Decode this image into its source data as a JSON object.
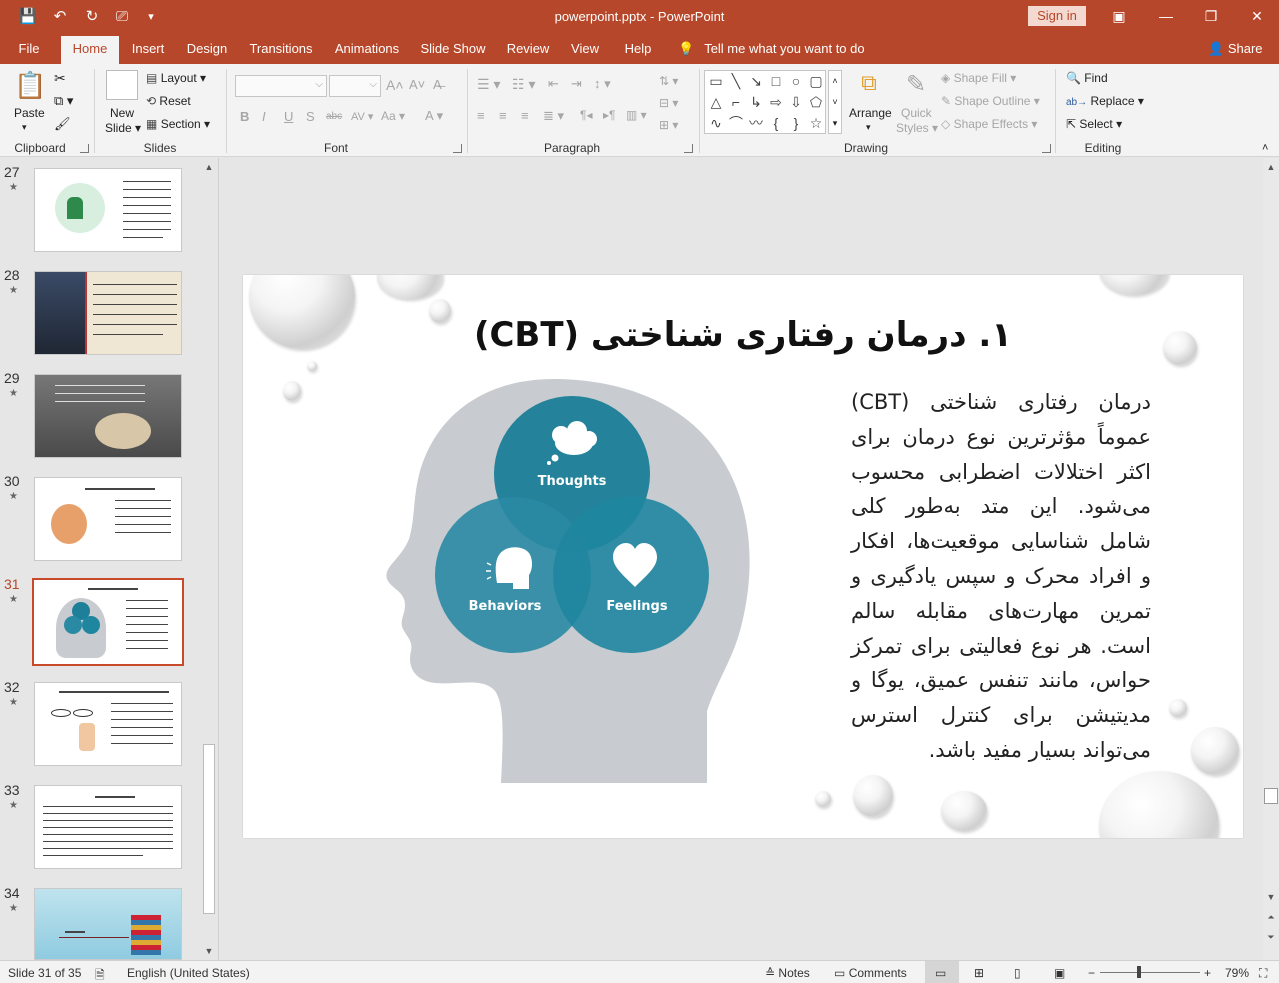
{
  "window": {
    "doc_title": "powerpoint.pptx  -  PowerPoint",
    "sign_in": "Sign in"
  },
  "tabs": [
    {
      "label": "File"
    },
    {
      "label": "Home"
    },
    {
      "label": "Insert"
    },
    {
      "label": "Design"
    },
    {
      "label": "Transitions"
    },
    {
      "label": "Animations"
    },
    {
      "label": "Slide Show"
    },
    {
      "label": "Review"
    },
    {
      "label": "View"
    },
    {
      "label": "Help"
    }
  ],
  "tell_me": "Tell me what you want to do",
  "share": "Share",
  "ribbon": {
    "clipboard": {
      "label": "Clipboard",
      "paste": "Paste"
    },
    "slides": {
      "label": "Slides",
      "new_slide_1": "New",
      "new_slide_2": "Slide",
      "layout": "Layout",
      "reset": "Reset",
      "section": "Section"
    },
    "font": {
      "label": "Font"
    },
    "paragraph": {
      "label": "Paragraph"
    },
    "drawing": {
      "label": "Drawing",
      "arrange": "Arrange",
      "quick_styles_1": "Quick",
      "quick_styles_2": "Styles",
      "shape_fill": "Shape Fill",
      "shape_outline": "Shape Outline",
      "shape_effects": "Shape Effects"
    },
    "editing": {
      "label": "Editing",
      "find": "Find",
      "replace": "Replace",
      "select": "Select"
    }
  },
  "thumbnails": [
    {
      "num": "27"
    },
    {
      "num": "28"
    },
    {
      "num": "29"
    },
    {
      "num": "30"
    },
    {
      "num": "31"
    },
    {
      "num": "32"
    },
    {
      "num": "33"
    },
    {
      "num": "34"
    }
  ],
  "slide": {
    "title": "۱. درمان رفتاری شناختی (CBT)",
    "body": "درمان رفتاری شناختی (CBT) عموماً مؤثرترین نوع درمان برای اکثر اختلالات اضطرابی محسوب می‌شود. این متد به‌طور کلی شامل شناسایی موقعیت‌ها، افکار و افراد محرک و سپس یادگیری و تمرین مهارت‌های مقابله سالم است. هر نوع فعالیتی برای تمرکز حواس، مانند تنفس عمیق، یوگا و مدیتیشن برای کنترل استرس می‌تواند بسیار مفید باشد.",
    "venn": {
      "thoughts": "Thoughts",
      "behaviors": "Behaviors",
      "feelings": "Feelings"
    },
    "colors": {
      "head": "#c8ccd0",
      "circle_top": "#1e7f99",
      "circle_left": "#2a8aa3",
      "circle_right": "#1f86a0"
    }
  },
  "status": {
    "slide_of": "Slide 31 of 35",
    "language": "English (United States)",
    "notes": "Notes",
    "comments": "Comments",
    "zoom": "79%"
  }
}
